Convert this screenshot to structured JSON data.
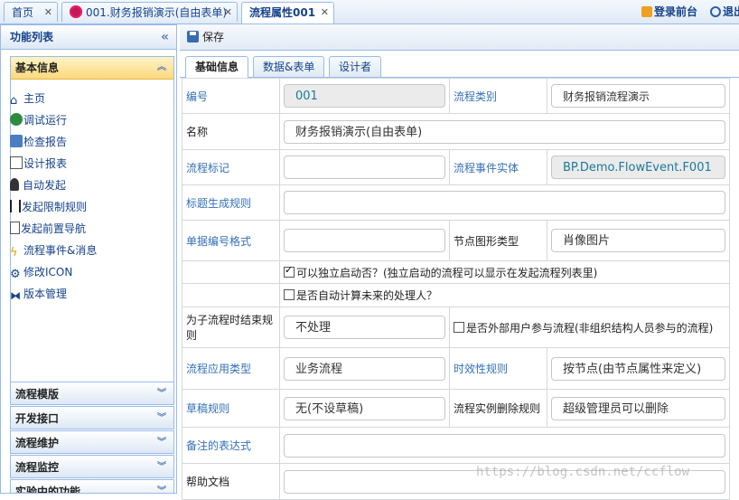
{
  "top_tabs": [
    {
      "label": "首页"
    },
    {
      "label": "001.财务报销演示(自由表单)"
    },
    {
      "label": "流程属性001"
    }
  ],
  "top_links": {
    "login": "登录前台",
    "exit": "退出"
  },
  "left_panel": {
    "title": "功能列表",
    "active_section": "基本信息",
    "items": [
      {
        "label": "主页",
        "icon": "home-icon"
      },
      {
        "label": "调试运行",
        "icon": "run-icon"
      },
      {
        "label": "检查报告",
        "icon": "report-icon"
      },
      {
        "label": "设计报表",
        "icon": "design-report-icon"
      },
      {
        "label": "自动发起",
        "icon": "auto-start-icon"
      },
      {
        "label": "发起限制规则",
        "icon": "limit-rule-icon"
      },
      {
        "label": "发起前置导航",
        "icon": "navigation-icon"
      },
      {
        "label": "流程事件&消息",
        "icon": "lightning-icon"
      },
      {
        "label": "修改ICON",
        "icon": "gear-icon"
      },
      {
        "label": "版本管理",
        "icon": "version-icon"
      }
    ],
    "sections": [
      {
        "label": "流程模版"
      },
      {
        "label": "开发接口"
      },
      {
        "label": "流程维护"
      },
      {
        "label": "流程监控"
      },
      {
        "label": "实验中的功能"
      }
    ]
  },
  "toolbar": {
    "save_label": "保存"
  },
  "sub_tabs": [
    {
      "label": "基础信息"
    },
    {
      "label": "数据&表单"
    },
    {
      "label": "设计者"
    }
  ],
  "form": {
    "no_label": "编号",
    "no_value": "001",
    "category_label": "流程类别",
    "category_value": "财务报销流程演示",
    "name_label": "名称",
    "name_value": "财务报销演示(自由表单)",
    "mark_label": "流程标记",
    "mark_value": "",
    "event_entity_label": "流程事件实体",
    "event_entity_value": "BP.Demo.FlowEvent.F001",
    "title_rule_label": "标题生成规则",
    "title_rule_value": "",
    "bill_format_label": "单据编号格式",
    "bill_format_value": "",
    "node_icon_label": "节点图形类型",
    "node_icon_value": "肖像图片",
    "can_start_label": "可以独立启动否？(独立启动的流程可以显示在发起流程列表里)",
    "can_start_checked": true,
    "auto_calc_label": "是否自动计算未来的处理人？",
    "auto_calc_checked": false,
    "subflow_end_label": "为子流程时结束规则",
    "subflow_end_value": "不处理",
    "external_user_label": "是否外部用户参与流程(非组织结构人员参与的流程)",
    "external_user_checked": false,
    "app_type_label": "流程应用类型",
    "app_type_value": "业务流程",
    "timeliness_label": "时效性规则",
    "timeliness_value": "按节点(由节点属性来定义)",
    "draft_label": "草稿规则",
    "draft_value": "无(不设草稿)",
    "delete_rule_label": "流程实例删除规则",
    "delete_rule_value": "超级管理员可以删除",
    "note_expr_label": "备注的表达式",
    "note_expr_value": "",
    "help_label": "帮助文档",
    "help_value": ""
  },
  "watermark": "https://blog.csdn.net/ccflow"
}
